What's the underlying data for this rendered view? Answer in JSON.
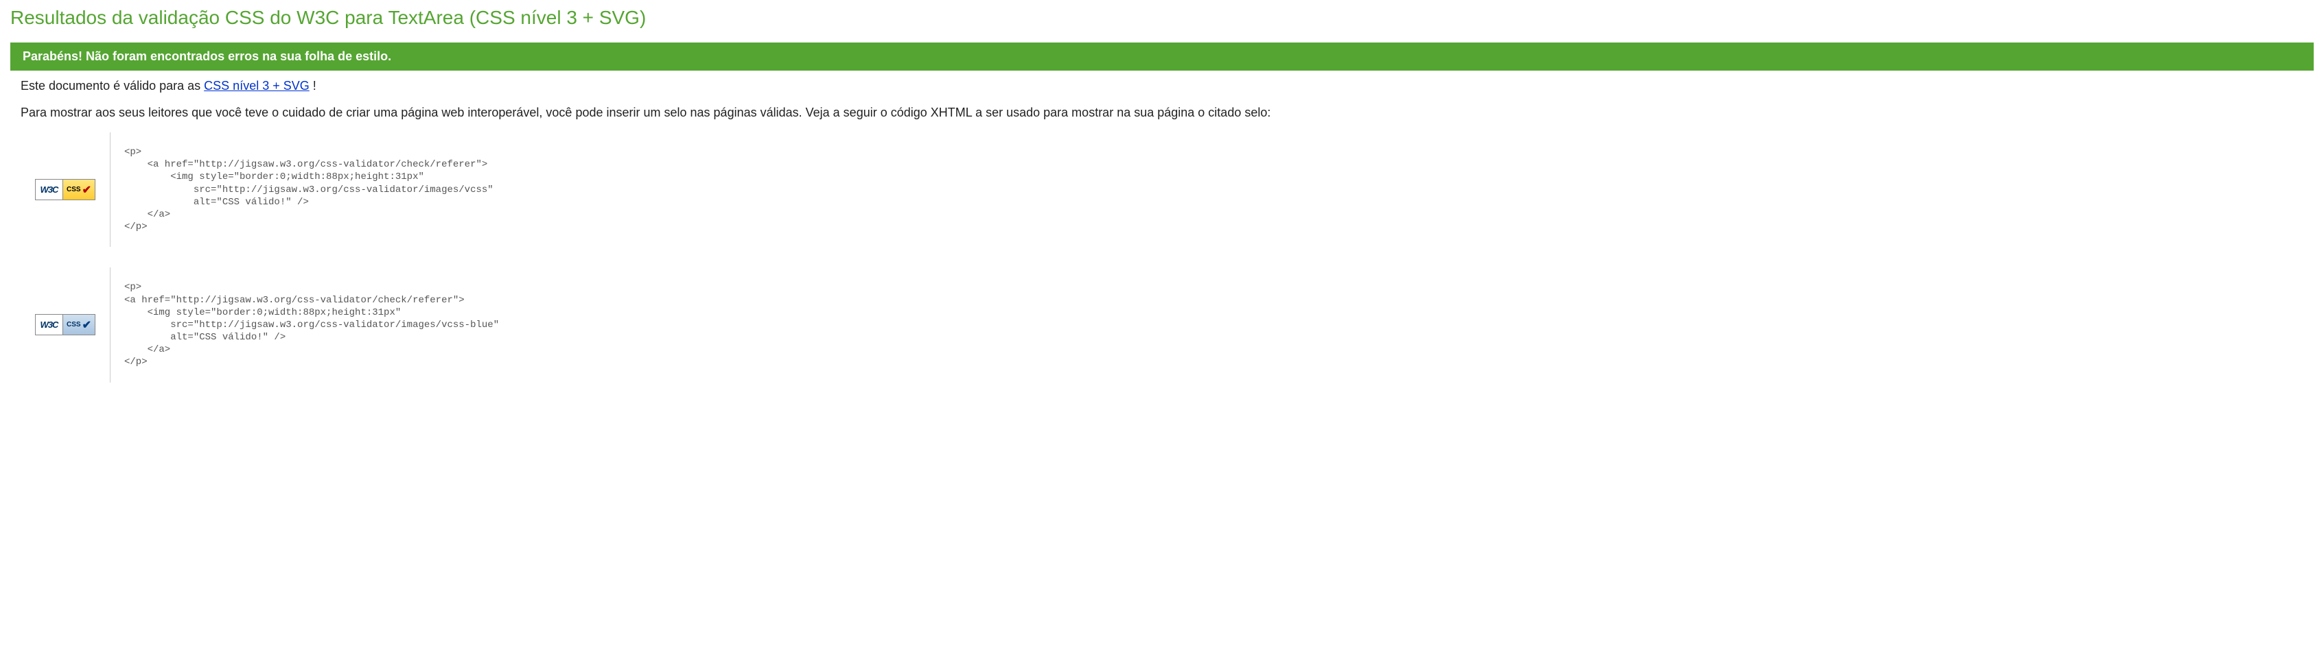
{
  "heading": "Resultados da validação CSS do W3C para TextArea (CSS nível 3 + SVG)",
  "congrats": "Parabéns! Não foram encontrados erros na sua folha de estilo.",
  "valid_doc": {
    "prefix": "Este documento é válido para as ",
    "link_text": "CSS nível 3 + SVG",
    "suffix": " !"
  },
  "intro_text": "Para mostrar aos seus leitores que você teve o cuidado de criar uma página web interoperável, você pode inserir um selo nas páginas válidas. Veja a seguir o código XHTML a ser usado para mostrar na sua página o citado selo:",
  "badges": {
    "w3c_label": "W3C",
    "css_label": "CSS"
  },
  "code_block_1": "<p>\n    <a href=\"http://jigsaw.w3.org/css-validator/check/referer\">\n        <img style=\"border:0;width:88px;height:31px\"\n            src=\"http://jigsaw.w3.org/css-validator/images/vcss\"\n            alt=\"CSS válido!\" />\n    </a>\n</p>",
  "code_block_2": "<p>\n<a href=\"http://jigsaw.w3.org/css-validator/check/referer\">\n    <img style=\"border:0;width:88px;height:31px\"\n        src=\"http://jigsaw.w3.org/css-validator/images/vcss-blue\"\n        alt=\"CSS válido!\" />\n    </a>\n</p>"
}
